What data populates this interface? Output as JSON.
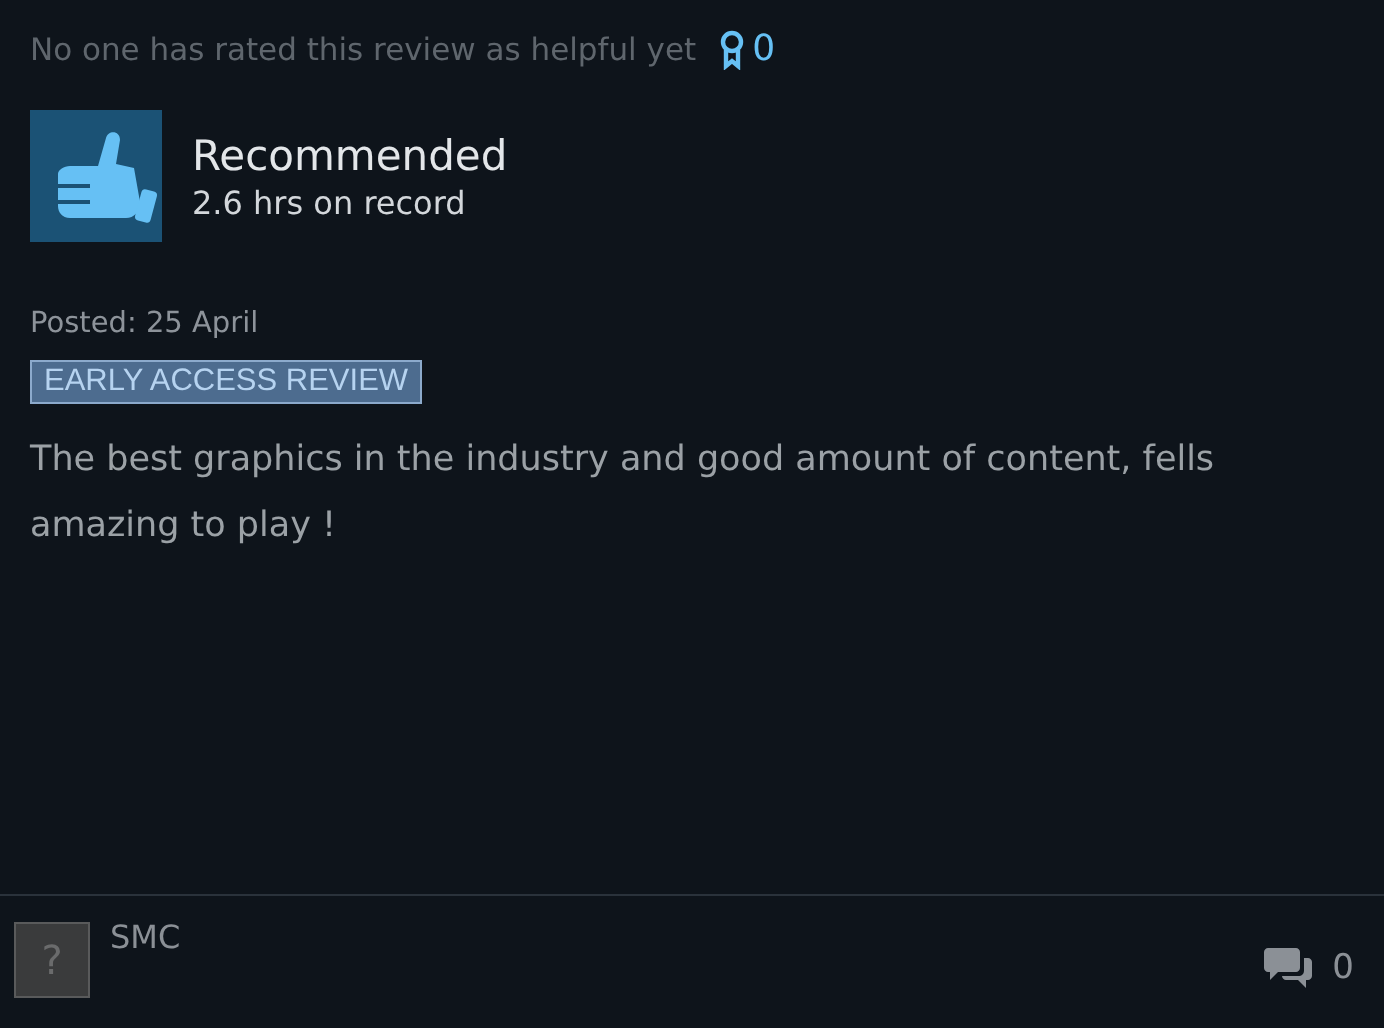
{
  "helpful": {
    "text": "No one has rated this review as helpful yet",
    "awards": "0"
  },
  "verdict": {
    "kind": "recommended",
    "title": "Recommended",
    "hours": "2.6 hrs on record"
  },
  "posted": "Posted: 25 April",
  "badge": "EARLY ACCESS REVIEW",
  "body": "The best graphics in the industry and good amount of content, fells amazing to play !",
  "author": {
    "avatar": "?",
    "name": "SMC",
    "comments": "0"
  }
}
